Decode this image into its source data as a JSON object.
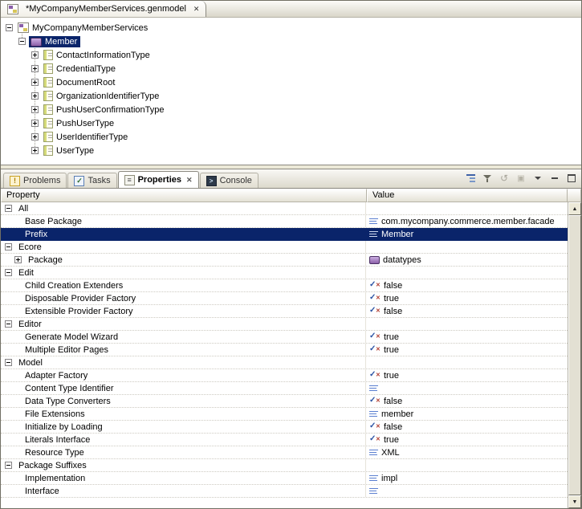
{
  "colors": {
    "selection": "#0a246a",
    "package_purple": "#8b5fa8",
    "class_yellow": "#d6dc7a",
    "value_icon_blue": "#5b7fd0"
  },
  "editor": {
    "tab": {
      "title": "*MyCompanyMemberServices.genmodel",
      "close_label": "✕",
      "icon": "genmodel-file-icon"
    },
    "tree": [
      {
        "label": "MyCompanyMemberServices",
        "level": 0,
        "expander": "minus",
        "icon": "genmodel"
      },
      {
        "label": "Member",
        "level": 1,
        "expander": "minus",
        "icon": "package",
        "selected": true
      },
      {
        "label": "ContactInformationType",
        "level": 2,
        "expander": "plus",
        "icon": "class"
      },
      {
        "label": "CredentialType",
        "level": 2,
        "expander": "plus",
        "icon": "class"
      },
      {
        "label": "DocumentRoot",
        "level": 2,
        "expander": "plus",
        "icon": "class"
      },
      {
        "label": "OrganizationIdentifierType",
        "level": 2,
        "expander": "plus",
        "icon": "class"
      },
      {
        "label": "PushUserConfirmationType",
        "level": 2,
        "expander": "plus",
        "icon": "class"
      },
      {
        "label": "PushUserType",
        "level": 2,
        "expander": "plus",
        "icon": "class"
      },
      {
        "label": "UserIdentifierType",
        "level": 2,
        "expander": "plus",
        "icon": "class"
      },
      {
        "label": "UserType",
        "level": 2,
        "expander": "plus",
        "icon": "class"
      }
    ]
  },
  "views": {
    "tabs": [
      {
        "label": "Problems",
        "icon": "problems"
      },
      {
        "label": "Tasks",
        "icon": "tasks"
      },
      {
        "label": "Properties",
        "icon": "properties",
        "active": true,
        "close_label": "✕"
      },
      {
        "label": "Console",
        "icon": "console"
      }
    ],
    "toolbar_icons": [
      "show-categories-icon",
      "show-advanced-icon",
      "restore-default-icon",
      "pin-view-icon",
      "view-menu-icon",
      "minimize-icon",
      "maximize-icon"
    ]
  },
  "properties": {
    "columns": [
      "Property",
      "Value"
    ],
    "rows": [
      {
        "type": "category",
        "label": "All"
      },
      {
        "type": "prop",
        "label": "Base Package",
        "value": "com.mycompany.commerce.member.facade",
        "icon": "text"
      },
      {
        "type": "prop",
        "label": "Prefix",
        "value": "Member",
        "icon": "text",
        "selected": true
      },
      {
        "type": "category",
        "label": "Ecore"
      },
      {
        "type": "prop",
        "label": "Package",
        "value": "datatypes",
        "icon": "package",
        "expander": "plus"
      },
      {
        "type": "category",
        "label": "Edit"
      },
      {
        "type": "prop",
        "label": "Child Creation Extenders",
        "value": "false",
        "icon": "bool"
      },
      {
        "type": "prop",
        "label": "Disposable Provider Factory",
        "value": "true",
        "icon": "bool"
      },
      {
        "type": "prop",
        "label": "Extensible Provider Factory",
        "value": "false",
        "icon": "bool"
      },
      {
        "type": "category",
        "label": "Editor"
      },
      {
        "type": "prop",
        "label": "Generate Model Wizard",
        "value": "true",
        "icon": "bool"
      },
      {
        "type": "prop",
        "label": "Multiple Editor Pages",
        "value": "true",
        "icon": "bool"
      },
      {
        "type": "category",
        "label": "Model"
      },
      {
        "type": "prop",
        "label": "Adapter Factory",
        "value": "true",
        "icon": "bool"
      },
      {
        "type": "prop",
        "label": "Content Type Identifier",
        "value": "",
        "icon": "text"
      },
      {
        "type": "prop",
        "label": "Data Type Converters",
        "value": "false",
        "icon": "bool"
      },
      {
        "type": "prop",
        "label": "File Extensions",
        "value": "member",
        "icon": "text"
      },
      {
        "type": "prop",
        "label": "Initialize by Loading",
        "value": "false",
        "icon": "bool"
      },
      {
        "type": "prop",
        "label": "Literals Interface",
        "value": "true",
        "icon": "bool"
      },
      {
        "type": "prop",
        "label": "Resource Type",
        "value": "XML",
        "icon": "text"
      },
      {
        "type": "category",
        "label": "Package Suffixes"
      },
      {
        "type": "prop",
        "label": "Implementation",
        "value": "impl",
        "icon": "text"
      },
      {
        "type": "prop",
        "label": "Interface",
        "value": "",
        "icon": "text"
      }
    ]
  }
}
